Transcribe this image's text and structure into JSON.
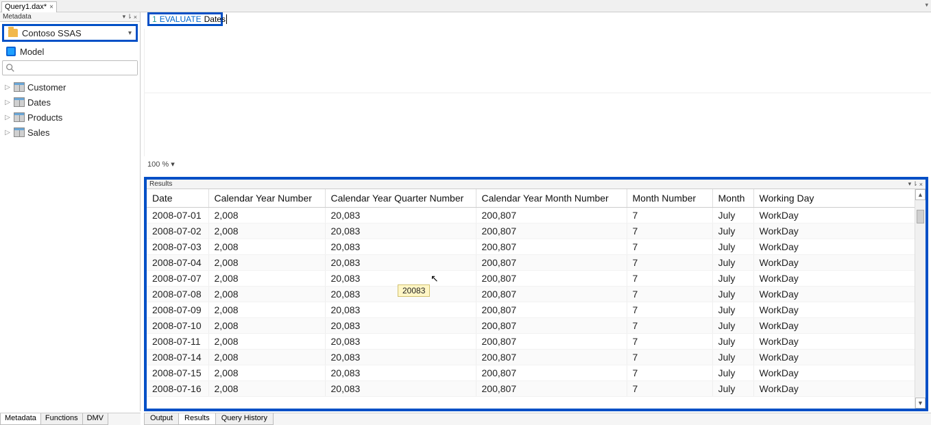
{
  "file_tab": {
    "label": "Query1.dax*",
    "close": "×"
  },
  "top_right_glyph": "▾",
  "metadata": {
    "title": "Metadata",
    "header_controls": {
      "dropdown": "▾",
      "pin": "⇂",
      "close": "×"
    },
    "database": {
      "name": "Contoso SSAS",
      "chevron": "▾"
    },
    "model": {
      "label": "Model"
    },
    "search": {
      "placeholder": ""
    },
    "tables": [
      "Customer",
      "Dates",
      "Products",
      "Sales"
    ],
    "bottom_tabs": [
      "Metadata",
      "Functions",
      "DMV"
    ]
  },
  "editor": {
    "line_number": "1",
    "keyword": "EVALUATE",
    "identifier": "Dates",
    "zoom": "100 % ▾"
  },
  "results": {
    "title": "Results",
    "header_controls": {
      "dropdown": "▾",
      "pin": "⇂",
      "close": "×"
    },
    "columns": [
      "Date",
      "Calendar Year Number",
      "Calendar Year Quarter Number",
      "Calendar Year Month Number",
      "Month Number",
      "Month",
      "Working Day"
    ],
    "rows": [
      [
        "2008-07-01",
        "2,008",
        "20,083",
        "200,807",
        "7",
        "July",
        "WorkDay"
      ],
      [
        "2008-07-02",
        "2,008",
        "20,083",
        "200,807",
        "7",
        "July",
        "WorkDay"
      ],
      [
        "2008-07-03",
        "2,008",
        "20,083",
        "200,807",
        "7",
        "July",
        "WorkDay"
      ],
      [
        "2008-07-04",
        "2,008",
        "20,083",
        "200,807",
        "7",
        "July",
        "WorkDay"
      ],
      [
        "2008-07-07",
        "2,008",
        "20,083",
        "200,807",
        "7",
        "July",
        "WorkDay"
      ],
      [
        "2008-07-08",
        "2,008",
        "20,083",
        "200,807",
        "7",
        "July",
        "WorkDay"
      ],
      [
        "2008-07-09",
        "2,008",
        "20,083",
        "200,807",
        "7",
        "July",
        "WorkDay"
      ],
      [
        "2008-07-10",
        "2,008",
        "20,083",
        "200,807",
        "7",
        "July",
        "WorkDay"
      ],
      [
        "2008-07-11",
        "2,008",
        "20,083",
        "200,807",
        "7",
        "July",
        "WorkDay"
      ],
      [
        "2008-07-14",
        "2,008",
        "20,083",
        "200,807",
        "7",
        "July",
        "WorkDay"
      ],
      [
        "2008-07-15",
        "2,008",
        "20,083",
        "200,807",
        "7",
        "July",
        "WorkDay"
      ],
      [
        "2008-07-16",
        "2,008",
        "20,083",
        "200,807",
        "7",
        "July",
        "WorkDay"
      ]
    ],
    "bottom_tabs": [
      "Output",
      "Results",
      "Query History"
    ],
    "scroll": {
      "up": "▲",
      "down": "▼"
    }
  },
  "tooltip": "20083"
}
